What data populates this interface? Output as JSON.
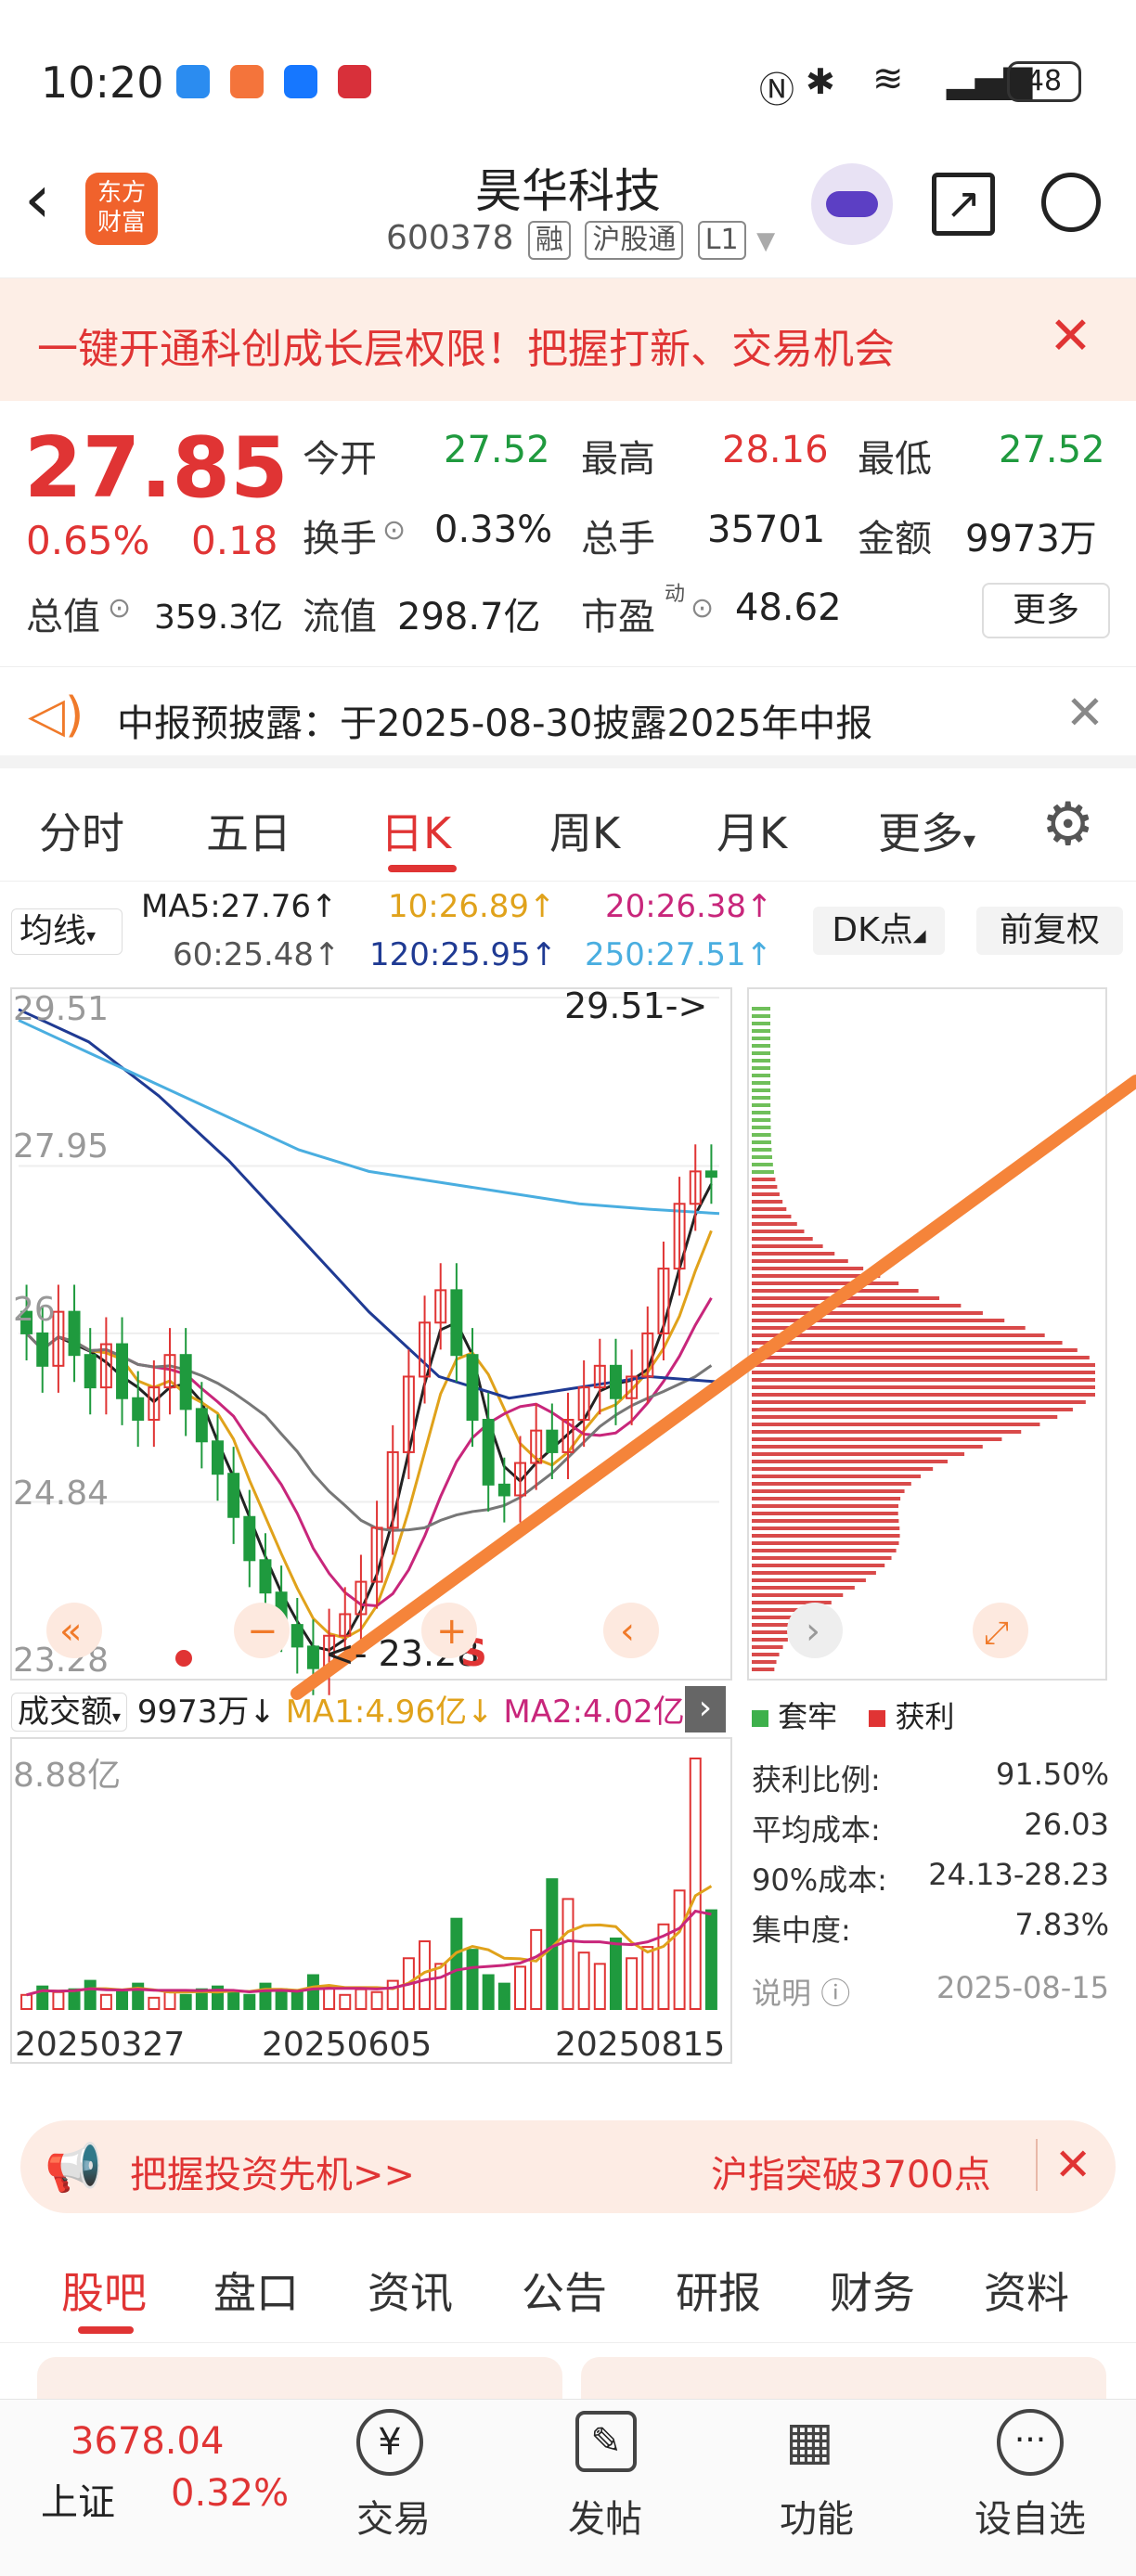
{
  "status_bar": {
    "time": "10:20",
    "battery": "48"
  },
  "header": {
    "app_logo": "东方\n财富",
    "stock_name": "昊华科技",
    "stock_code": "600378",
    "tags": [
      "融",
      "沪股通",
      "L1"
    ]
  },
  "banner": {
    "text": "一键开通科创成长层权限！把握打新、交易机会"
  },
  "quote": {
    "price": "27.85",
    "change_pct": "0.65%",
    "change_amt": "0.18",
    "items": [
      {
        "label": "今开",
        "value": "27.52"
      },
      {
        "label": "最高",
        "value": "28.16"
      },
      {
        "label": "最低",
        "value": "27.52"
      },
      {
        "label": "换手",
        "value": "0.33%"
      },
      {
        "label": "总手",
        "value": "35701"
      },
      {
        "label": "金额",
        "value": "9973万"
      },
      {
        "label": "流值",
        "value": "298.7亿"
      },
      {
        "label": "市盈",
        "value": "48.62"
      }
    ],
    "total_value_label": "总值",
    "total_value": "359.3亿",
    "pe_sup": "动",
    "more": "更多"
  },
  "notice": {
    "text": "中报预披露：于2025-08-30披露2025年中报"
  },
  "periods": [
    "分时",
    "五日",
    "日K",
    "周K",
    "月K",
    "更多",
    "settings"
  ],
  "active_period": "日K",
  "ma_legend": {
    "selector": "均线",
    "ma5": "MA5:27.76↑",
    "ma10": "10:26.89↑",
    "ma20": "20:26.38↑",
    "ma60": "60:25.48↑",
    "ma120": "120:25.95↑",
    "ma250": "250:27.51↑",
    "dk_button": "DK点",
    "adjust_button": "前复权"
  },
  "chart_data": {
    "type": "candlestick",
    "y_ticks": [
      "29.51",
      "27.95",
      "26",
      "24.84",
      "23.28"
    ],
    "max_label": "29.51->",
    "min_label": "<- 23.28",
    "x_labels": [
      "20250327",
      "20250605",
      "20250815"
    ],
    "close_series": [
      26.4,
      26.1,
      26.6,
      26.2,
      25.9,
      26.3,
      25.8,
      25.6,
      25.9,
      26.2,
      25.7,
      25.4,
      25.1,
      24.7,
      24.3,
      24.0,
      23.7,
      23.5,
      23.3,
      23.6,
      23.8,
      24.1,
      24.6,
      25.3,
      26.0,
      26.5,
      26.8,
      26.2,
      25.6,
      25.0,
      24.9,
      25.2,
      25.5,
      25.3,
      25.6,
      25.9,
      26.1,
      25.8,
      26.0,
      26.4,
      27.0,
      27.6,
      27.9,
      27.85
    ],
    "volume_label": "成交额",
    "volume_value": "9973万↓",
    "vol_ma1": "MA1:4.96亿↓",
    "vol_ma2": "MA2:4.02亿↓",
    "volume_max": "8.88亿",
    "volume_bars": [
      0.5,
      0.8,
      0.6,
      0.7,
      1.0,
      0.5,
      0.6,
      0.9,
      0.4,
      0.6,
      0.5,
      0.7,
      0.8,
      0.6,
      0.5,
      0.9,
      0.7,
      0.6,
      1.2,
      0.8,
      0.5,
      0.7,
      0.6,
      1.0,
      1.8,
      2.4,
      1.6,
      3.2,
      2.1,
      1.2,
      0.9,
      1.5,
      2.8,
      4.6,
      3.9,
      2.0,
      1.6,
      2.5,
      1.8,
      2.2,
      3.0,
      4.2,
      8.88,
      3.5
    ],
    "chip_legend_trapped": "套牢",
    "chip_legend_profit": "获利"
  },
  "chip_stats": [
    {
      "label": "获利比例:",
      "value": "91.50%"
    },
    {
      "label": "平均成本:",
      "value": "26.03"
    },
    {
      "label": "90%成本:",
      "value": "24.13-28.23"
    },
    {
      "label": "集中度:",
      "value": "7.83%"
    }
  ],
  "chip_note": {
    "label": "说明",
    "date": "2025-08-15"
  },
  "promo": {
    "left": "把握投资先机>>",
    "right": "沪指突破3700点"
  },
  "bottom_tabs": [
    "股吧",
    "盘口",
    "资讯",
    "公告",
    "研报",
    "财务",
    "资料"
  ],
  "tab_bar": {
    "index_value": "3678.04",
    "index_name": "上证",
    "index_change": "0.32%",
    "items": [
      "交易",
      "发帖",
      "功能",
      "设自选"
    ]
  },
  "colors": {
    "up": "#e03434",
    "down": "#1f9a3e",
    "accent": "#f07a2a"
  }
}
